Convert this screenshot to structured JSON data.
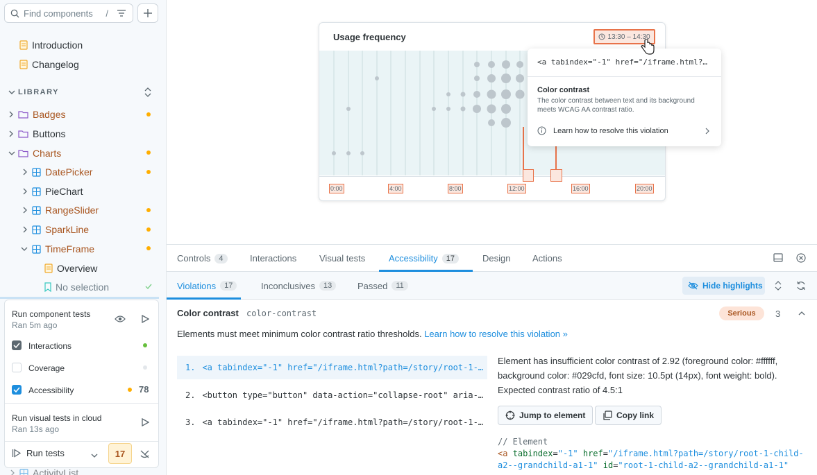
{
  "sidebar": {
    "search_placeholder": "Find components",
    "search_shortcut": "/",
    "docs": [
      {
        "label": "Introduction"
      },
      {
        "label": "Changelog"
      }
    ],
    "section_label": "LIBRARY",
    "tree": [
      {
        "label": "Badges",
        "dot": true
      },
      {
        "label": "Buttons",
        "dot": false
      },
      {
        "label": "Charts",
        "dot": true
      },
      {
        "label": "DatePicker",
        "dot": true
      },
      {
        "label": "PieChart",
        "dot": false
      },
      {
        "label": "RangeSlider",
        "dot": true
      },
      {
        "label": "SparkLine",
        "dot": true
      },
      {
        "label": "TimeFrame",
        "dot": true
      },
      {
        "label": "Overview"
      },
      {
        "label": "No selection"
      },
      {
        "label": "ActivityList"
      }
    ],
    "tests": {
      "run_component": "Run component tests",
      "run_component_time": "Ran 5m ago",
      "interactions": "Interactions",
      "coverage": "Coverage",
      "accessibility": "Accessibility",
      "accessibility_count": "78",
      "run_visual": "Run visual tests in cloud",
      "run_visual_time": "Ran 13s ago",
      "run_tests": "Run tests",
      "badge_count": "17"
    }
  },
  "preview": {
    "card_title": "Usage frequency",
    "time_range": "13:30 – 14:30",
    "axis_ticks": [
      "0:00",
      "4:00",
      "8:00",
      "12:00",
      "16:00",
      "20:00"
    ],
    "popover": {
      "element": "<a tabindex=\"-1\" href=\"/iframe.html?…",
      "title": "Color contrast",
      "description": "The color contrast between text and its background meets WCAG AA contrast ratio.",
      "link": "Learn how to resolve this violation"
    }
  },
  "panel": {
    "tabs": [
      {
        "label": "Controls",
        "count": "4"
      },
      {
        "label": "Interactions",
        "count": ""
      },
      {
        "label": "Visual tests",
        "count": ""
      },
      {
        "label": "Accessibility",
        "count": "17"
      },
      {
        "label": "Design",
        "count": ""
      },
      {
        "label": "Actions",
        "count": ""
      }
    ],
    "subtabs": [
      {
        "label": "Violations",
        "count": "17"
      },
      {
        "label": "Inconclusives",
        "count": "13"
      },
      {
        "label": "Passed",
        "count": "11"
      }
    ],
    "hide_highlights": "Hide highlights",
    "rule": {
      "title": "Color contrast",
      "id": "color-contrast",
      "severity": "Serious",
      "count": "3",
      "description": "Elements must meet minimum color contrast ratio thresholds.",
      "learn_link": "Learn how to resolve this violation »"
    },
    "nodes": [
      {
        "num": "1.",
        "code": "<a tabindex=\"-1\" href=\"/iframe.html?path=/story/root-1-…"
      },
      {
        "num": "2.",
        "code": "<button type=\"button\" data-action=\"collapse-root\" aria-…"
      },
      {
        "num": "3.",
        "code": "<a tabindex=\"-1\" href=\"/iframe.html?path=/story/root-1-…"
      }
    ],
    "detail_text": "Element has insufficient color contrast of 2.92 (foreground color: #ffffff, background color: #029cfd, font size: 10.5pt (14px), font weight: bold). Expected contrast ratio of 4.5:1",
    "jump_label": "Jump to element",
    "copy_label": "Copy link",
    "code_comment": "// Element",
    "code_line1_tag": "<a",
    "code_line1_attr1": "tabindex",
    "code_line1_val1": "\"-1\"",
    "code_line1_attr2": "href",
    "code_line1_val2": "\"/iframe.html?path=/story/root-1-child-",
    "code_line2_val": "a2--grandchild-a1-1\"",
    "code_line2_attr": "id",
    "code_line2_val2": "\"root-1-child-a2--grandchild-a1-1\""
  }
}
